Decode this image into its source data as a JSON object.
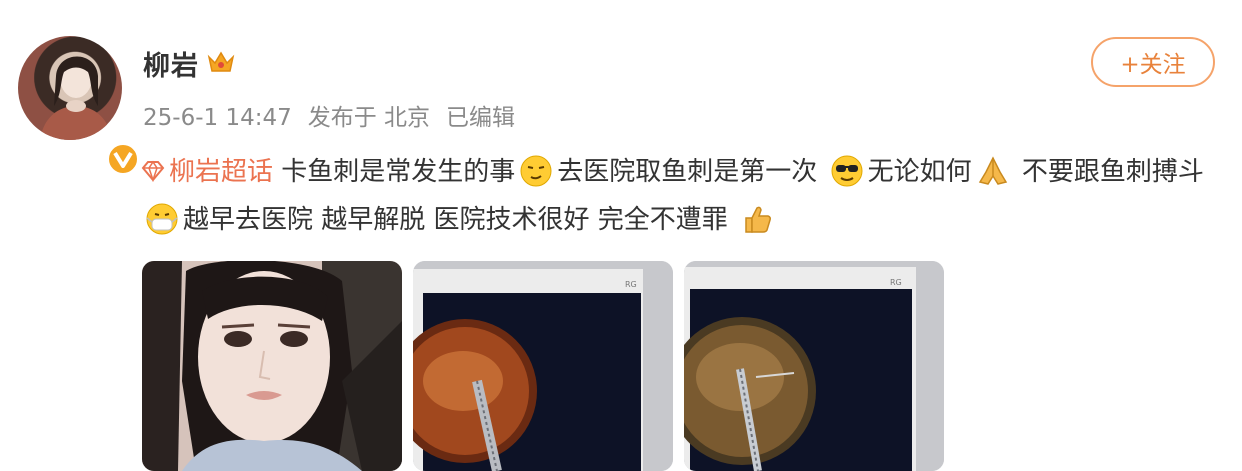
{
  "user": {
    "name": "柳岩"
  },
  "meta": {
    "time": "25-6-1 14:47",
    "source": "发布于 北京",
    "edited": "已编辑"
  },
  "follow": {
    "label": "+关注"
  },
  "post": {
    "topic": "柳岩超话",
    "seg1": "卡鱼刺是常发生的事",
    "seg2": "去医院取鱼刺是第一次",
    "seg3": "无论如何",
    "seg4": "不要跟鱼刺搏斗",
    "seg5": "越早去医院 越早解脱 医院技术很好 完全不遭罪"
  },
  "icons": {
    "verified": "verified-badge-icon",
    "crown": "crown-icon",
    "topic": "super-topic-icon",
    "emojis": [
      "smirk-emoji",
      "sunglasses-emoji",
      "pray-emoji",
      "mask-emoji",
      "thumbs-up-emoji"
    ]
  },
  "colors": {
    "accent": "#eb7350",
    "follow": "#e8823b",
    "badge": "#f5a623",
    "meta": "#8a8a8a"
  }
}
